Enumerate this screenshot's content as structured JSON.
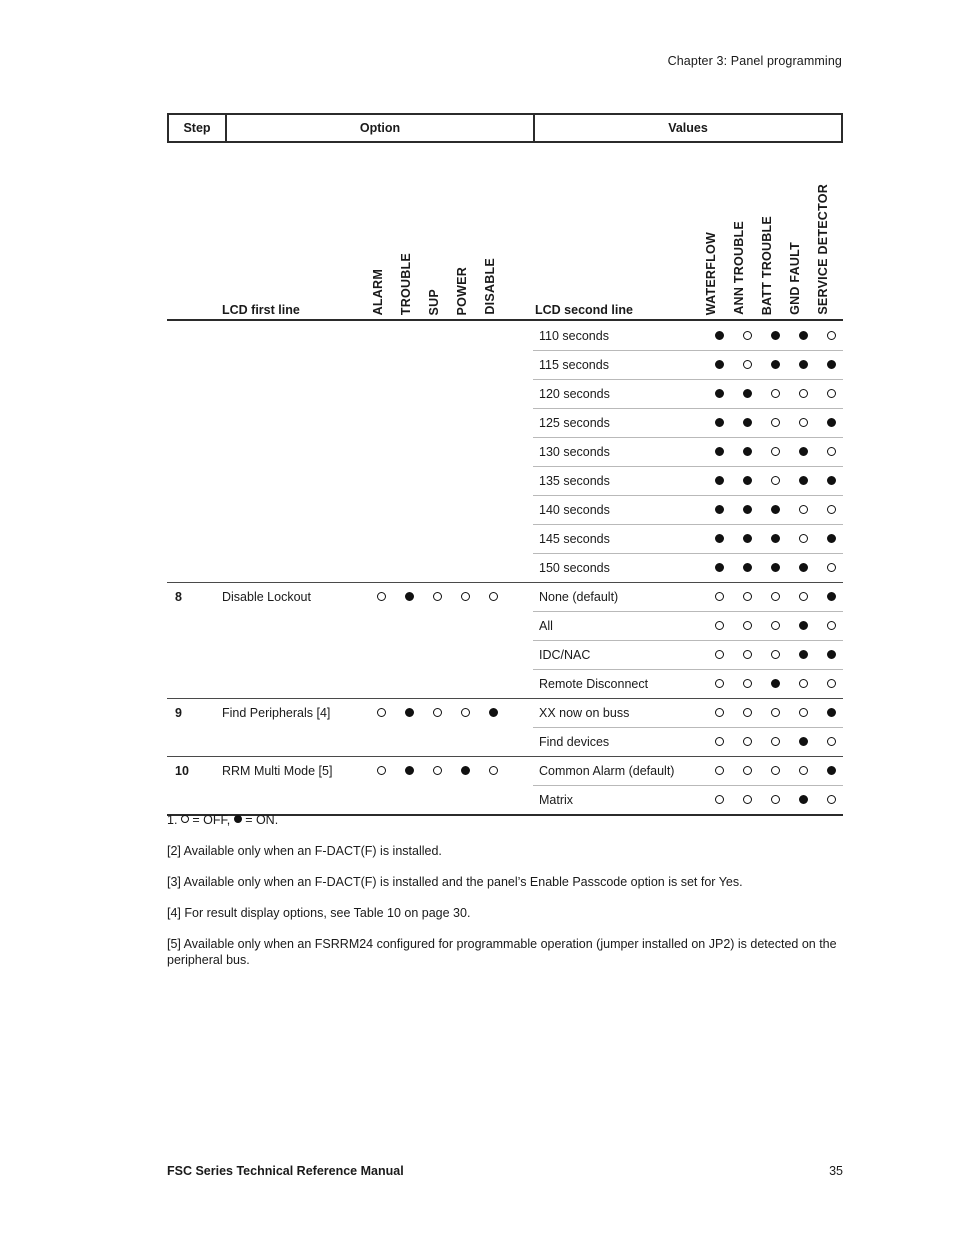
{
  "running_head": "Chapter 3: Panel programming",
  "table": {
    "header": {
      "step": "Step",
      "option": "Option",
      "values": "Values"
    },
    "subheader": {
      "lcd_first_line": "LCD first line",
      "lcd_second_line": "LCD second line",
      "option_flags": [
        "ALARM",
        "TROUBLE",
        "SUP",
        "POWER",
        "DISABLE"
      ],
      "value_flags": [
        "WATERFLOW",
        "ANN TROUBLE",
        "BATT TROUBLE",
        "GND FAULT",
        "SERVICE DETECTOR"
      ]
    },
    "rows": [
      {
        "step": "",
        "option": "",
        "option_dots": null,
        "second": "110 seconds",
        "value_dots": [
          1,
          0,
          1,
          1,
          0
        ],
        "group_start": false
      },
      {
        "step": "",
        "option": "",
        "option_dots": null,
        "second": "115 seconds",
        "value_dots": [
          1,
          0,
          1,
          1,
          1
        ],
        "group_start": false
      },
      {
        "step": "",
        "option": "",
        "option_dots": null,
        "second": "120 seconds",
        "value_dots": [
          1,
          1,
          0,
          0,
          0
        ],
        "group_start": false
      },
      {
        "step": "",
        "option": "",
        "option_dots": null,
        "second": "125 seconds",
        "value_dots": [
          1,
          1,
          0,
          0,
          1
        ],
        "group_start": false
      },
      {
        "step": "",
        "option": "",
        "option_dots": null,
        "second": "130 seconds",
        "value_dots": [
          1,
          1,
          0,
          1,
          0
        ],
        "group_start": false
      },
      {
        "step": "",
        "option": "",
        "option_dots": null,
        "second": "135 seconds",
        "value_dots": [
          1,
          1,
          0,
          1,
          1
        ],
        "group_start": false
      },
      {
        "step": "",
        "option": "",
        "option_dots": null,
        "second": "140 seconds",
        "value_dots": [
          1,
          1,
          1,
          0,
          0
        ],
        "group_start": false
      },
      {
        "step": "",
        "option": "",
        "option_dots": null,
        "second": "145 seconds",
        "value_dots": [
          1,
          1,
          1,
          0,
          1
        ],
        "group_start": false
      },
      {
        "step": "",
        "option": "",
        "option_dots": null,
        "second": "150 seconds",
        "value_dots": [
          1,
          1,
          1,
          1,
          0
        ],
        "group_start": false
      },
      {
        "step": "8",
        "option": "Disable Lockout",
        "option_dots": [
          0,
          1,
          0,
          0,
          0
        ],
        "second": "None (default)",
        "value_dots": [
          0,
          0,
          0,
          0,
          1
        ],
        "group_start": true
      },
      {
        "step": "",
        "option": "",
        "option_dots": null,
        "second": "All",
        "value_dots": [
          0,
          0,
          0,
          1,
          0
        ],
        "group_start": false
      },
      {
        "step": "",
        "option": "",
        "option_dots": null,
        "second": "IDC/NAC",
        "value_dots": [
          0,
          0,
          0,
          1,
          1
        ],
        "group_start": false
      },
      {
        "step": "",
        "option": "",
        "option_dots": null,
        "second": "Remote Disconnect",
        "value_dots": [
          0,
          0,
          1,
          0,
          0
        ],
        "group_start": false
      },
      {
        "step": "9",
        "option": "Find Peripherals [4]",
        "option_dots": [
          0,
          1,
          0,
          0,
          1
        ],
        "second": "XX now on buss",
        "value_dots": [
          0,
          0,
          0,
          0,
          1
        ],
        "group_start": true
      },
      {
        "step": "",
        "option": "",
        "option_dots": null,
        "second": "Find devices",
        "value_dots": [
          0,
          0,
          0,
          1,
          0
        ],
        "group_start": false
      },
      {
        "step": "10",
        "option": "RRM Multi Mode [5]",
        "option_dots": [
          0,
          1,
          0,
          1,
          0
        ],
        "second": "Common Alarm (default)",
        "value_dots": [
          0,
          0,
          0,
          0,
          1
        ],
        "group_start": true
      },
      {
        "step": "",
        "option": "",
        "option_dots": null,
        "second": "Matrix",
        "value_dots": [
          0,
          0,
          0,
          1,
          0
        ],
        "group_start": false
      }
    ]
  },
  "notes": {
    "note1_prefix": "1. ",
    "note1_mid": " = OFF, ",
    "note1_suffix": " = ON.",
    "note2": "[2] Available only when an F-DACT(F) is installed.",
    "note3": "[3] Available only when an F-DACT(F) is installed and the panel’s Enable Passcode option is set for Yes.",
    "note4": "[4] For result display options, see Table 10 on page 30.",
    "note5": "[5] Available only when an FSRRM24 configured for programmable operation (jumper installed on JP2) is detected on the peripheral bus."
  },
  "footer": {
    "title": "FSC Series Technical Reference Manual",
    "page": "35"
  }
}
